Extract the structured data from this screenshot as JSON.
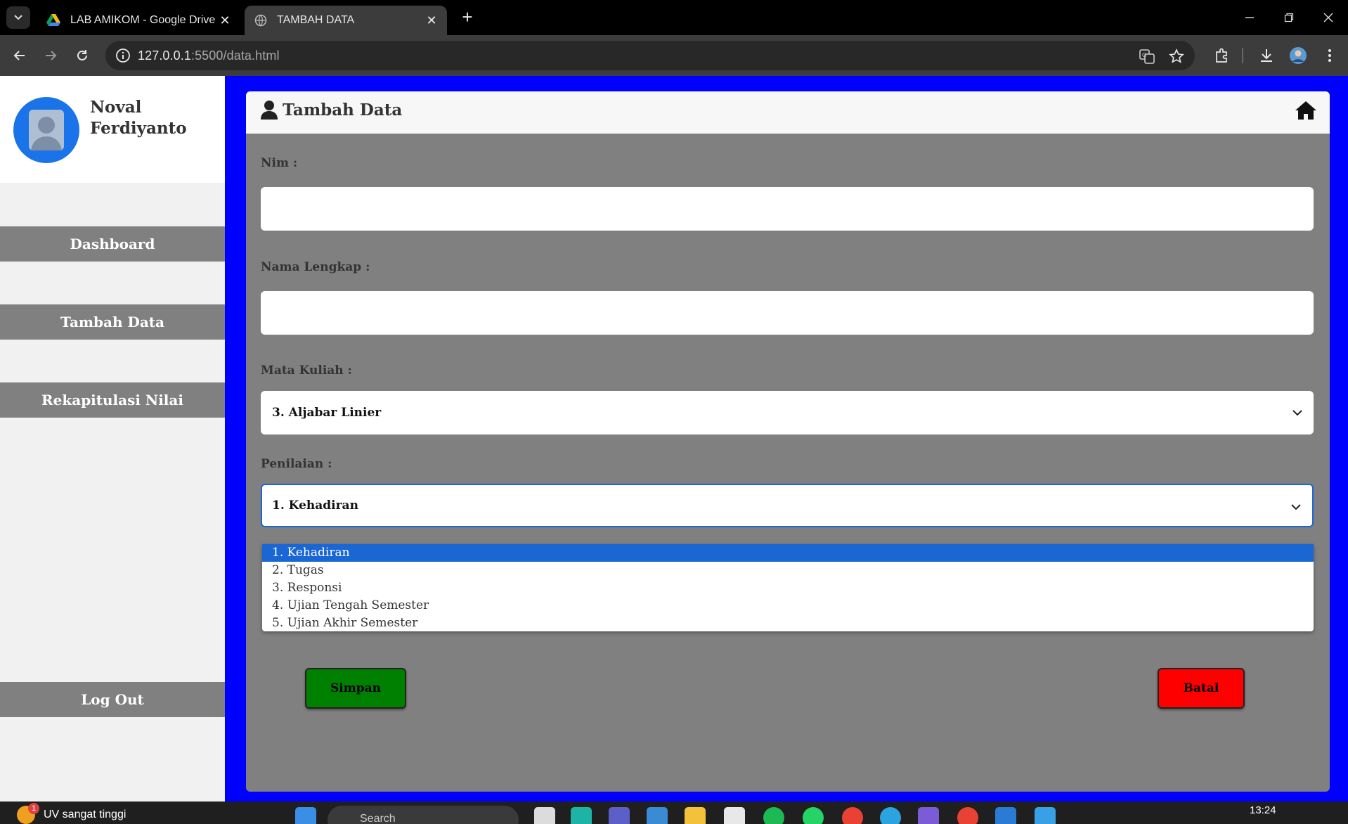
{
  "browser": {
    "tabs": [
      {
        "title": "LAB AMIKOM - Google Drive",
        "active": false
      },
      {
        "title": "TAMBAH DATA",
        "active": true
      }
    ],
    "url_host": "127.0.0.1",
    "url_path": ":5500/data.html"
  },
  "sidebar": {
    "user_name": "Noval Ferdiyanto",
    "items": [
      {
        "label": "Dashboard"
      },
      {
        "label": "Tambah Data"
      },
      {
        "label": "Rekapitulasi Nilai"
      }
    ],
    "logout_label": "Log Out"
  },
  "card": {
    "title": "Tambah Data"
  },
  "form": {
    "nim_label": "Nim :",
    "nim_value": "",
    "nama_label": "Nama Lengkap :",
    "nama_value": "",
    "matkul_label": "Mata Kuliah :",
    "matkul_selected": "3. Aljabar Linier",
    "penilaian_label": "Penilaian :",
    "penilaian_selected": "1. Kehadiran",
    "penilaian_options": [
      "1. Kehadiran",
      "2. Tugas",
      "3. Responsi",
      "4. Ujian Tengah Semester",
      "5. Ujian Akhir Semester"
    ],
    "save_label": "Simpan",
    "cancel_label": "Batal"
  },
  "taskbar": {
    "weather_text": "UV sangat tinggi",
    "weather_badge": "1",
    "search_text": "Search",
    "clock": "13:24"
  },
  "colors": {
    "page_bg": "#0000ff",
    "card_bg": "#808080",
    "save_button": "#008000",
    "cancel_button": "#ff0000",
    "selected_option": "#1a66d4"
  }
}
